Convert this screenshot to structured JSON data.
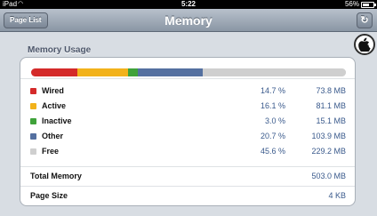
{
  "statusbar": {
    "carrier": "iPad",
    "time": "5:22",
    "battery": "56%"
  },
  "navbar": {
    "back_label": "Page List",
    "title": "Memory",
    "refresh_glyph": "↻"
  },
  "section": {
    "title": "Memory Usage"
  },
  "colors": {
    "wired": "#d42a2a",
    "active": "#f2b21b",
    "inactive": "#3fa23a",
    "other": "#5470a0",
    "free": "#cfcfcf"
  },
  "usage": {
    "segments": [
      {
        "key": "wired",
        "fraction": 0.147
      },
      {
        "key": "active",
        "fraction": 0.161
      },
      {
        "key": "inactive",
        "fraction": 0.03
      },
      {
        "key": "other",
        "fraction": 0.207
      },
      {
        "key": "free",
        "fraction": 0.456
      }
    ]
  },
  "legend": [
    {
      "key": "wired",
      "name": "Wired",
      "percent": "14.7 %",
      "size": "73.8 MB"
    },
    {
      "key": "active",
      "name": "Active",
      "percent": "16.1 %",
      "size": "81.1 MB"
    },
    {
      "key": "inactive",
      "name": "Inactive",
      "percent": "3.0 %",
      "size": "15.1 MB"
    },
    {
      "key": "other",
      "name": "Other",
      "percent": "20.7 %",
      "size": "103.9 MB"
    },
    {
      "key": "free",
      "name": "Free",
      "percent": "45.6 %",
      "size": "229.2 MB"
    }
  ],
  "totals": {
    "total_memory_label": "Total Memory",
    "total_memory_value": "503.0 MB",
    "page_size_label": "Page Size",
    "page_size_value": "4 KB"
  }
}
